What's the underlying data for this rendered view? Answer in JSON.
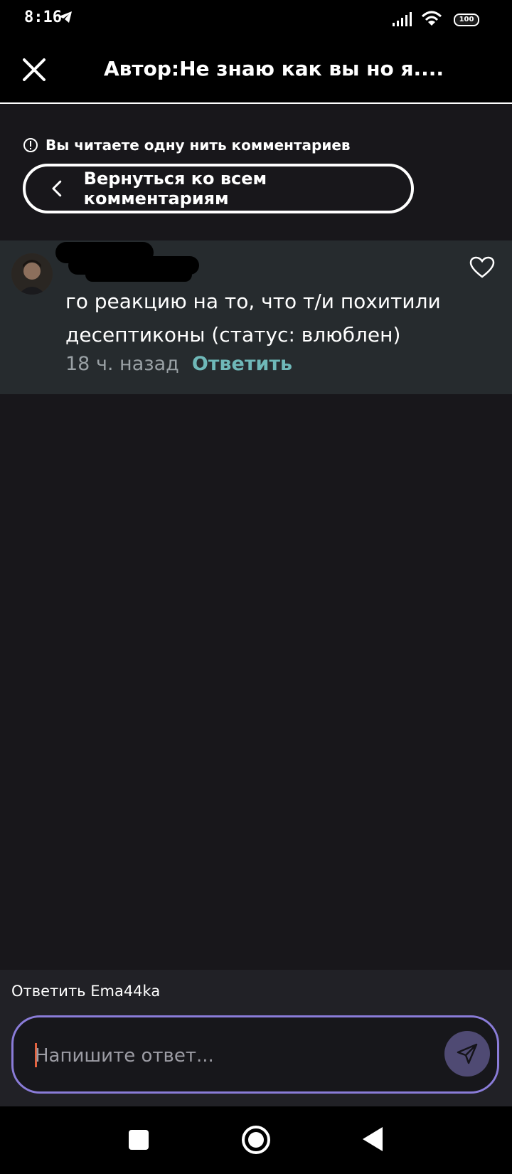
{
  "status_bar": {
    "time": "8:16",
    "battery": "100",
    "icons": [
      "telegram-icon",
      "signal-icon",
      "wifi-icon",
      "battery-icon"
    ]
  },
  "header": {
    "title": "Автор:Не знаю как вы но я....",
    "close_icon": "close-icon"
  },
  "thread": {
    "notice": "Вы читаете одну нить комментариев",
    "notice_icon": "info-icon",
    "back_label": "Вернуться ко всем комментариям"
  },
  "comment": {
    "text": "го реакцию на то, что т/и похитили десептиконы (статус: влюблен)",
    "time": "18 ч. назад",
    "reply_label": "Ответить",
    "like_icon": "heart-icon"
  },
  "composer": {
    "reply_to": "Ответить Ema44ka",
    "placeholder": "Напишите ответ...",
    "send_icon": "send-icon"
  },
  "colors": {
    "background": "#18171b",
    "comment_bg": "#262b2e",
    "reply_accent": "#6fb8b8",
    "input_border": "#8a7cd8",
    "send_bg": "#4f4a73"
  }
}
